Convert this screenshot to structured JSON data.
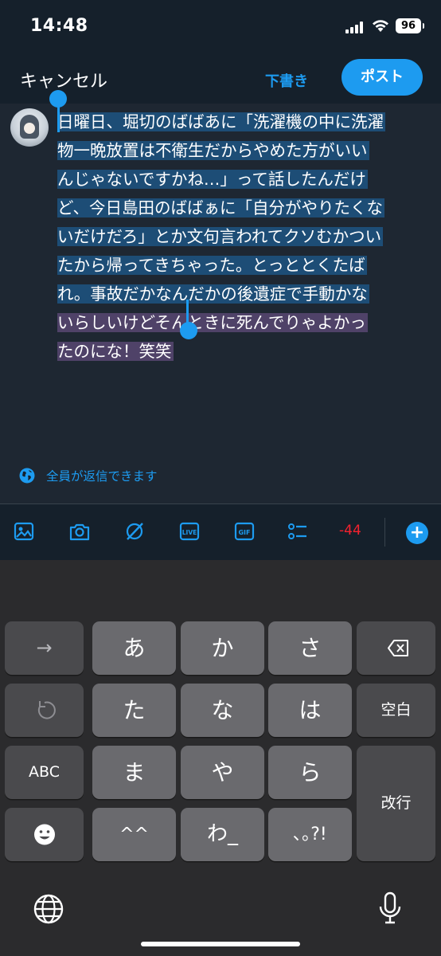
{
  "status": {
    "time": "14:48",
    "battery": "96"
  },
  "header": {
    "cancel": "キャンセル",
    "draft": "下書き",
    "post": "ポスト"
  },
  "compose": {
    "lines": [
      "日曜日、堀切のばばあに「洗濯機の中に洗濯",
      "物一晩放置は不衛生だからやめた方がいい",
      "んじゃないですかね…」って話したんだけ",
      "ど、今日島田のばばぁに「自分がやりたくな",
      "いだけだろ」とか文句言われてクソむかつい",
      "たから帰ってきちゃった。とっととくたば",
      "れ。事故だかなんだかの後遺症で手動かな",
      "いらしいけどそんときに死んでりゃよかっ",
      "たのにな！笑笑"
    ]
  },
  "reply_setting": "全員が返信できます",
  "toolbar": {
    "char_count": "-44",
    "add": "+"
  },
  "keyboard": {
    "row1": [
      "→",
      "あ",
      "か",
      "さ"
    ],
    "row2": [
      "",
      "た",
      "な",
      "は",
      "空白"
    ],
    "row3": [
      "ABC",
      "ま",
      "や",
      "ら",
      "改行"
    ],
    "row4": [
      "",
      "^^",
      "わ_",
      "､｡?!"
    ]
  },
  "colors": {
    "accent": "#1d9bf0",
    "background": "#15202b",
    "negative_count": "#f4212e"
  }
}
